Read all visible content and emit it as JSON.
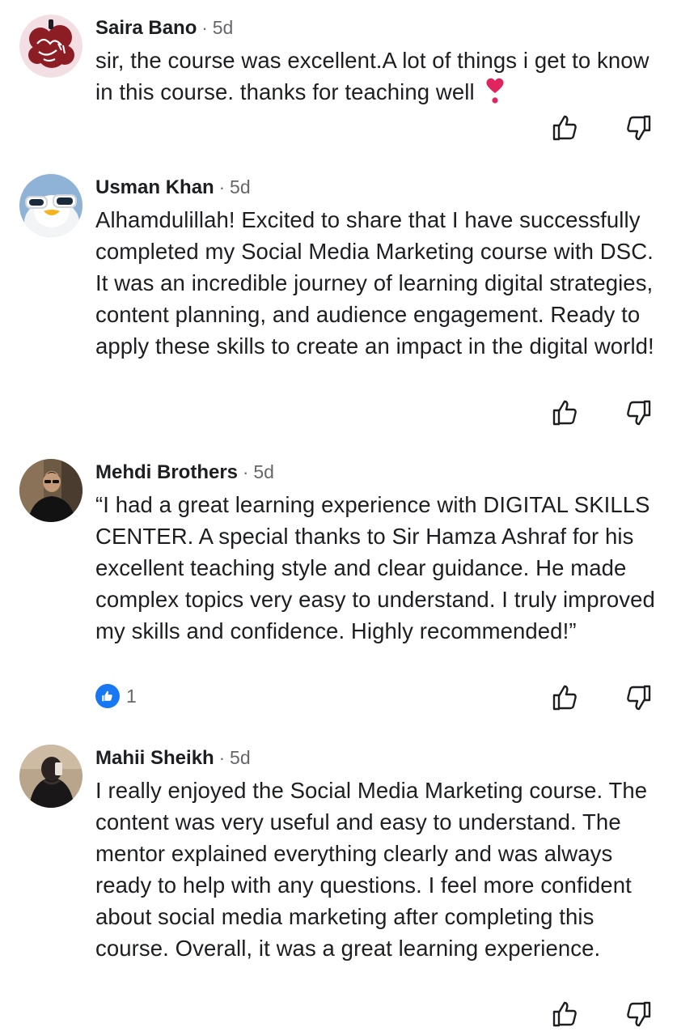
{
  "comments": [
    {
      "author": "Saira Bano",
      "separator": "·",
      "time": "5d",
      "text": "sir, the course was excellent.A lot of things i get to know in this course. thanks for teaching well",
      "emoji": "heart-exclamation-icon",
      "avatar": "calligraphy-avatar"
    },
    {
      "author": "Usman Khan",
      "separator": "·",
      "time": "5d",
      "text": "Alhamdulillah! Excited to share that I have successfully completed my Social Media Marketing course with DSC. It was an incredible journey of learning digital strategies, content planning, and audience engagement. Ready to apply these skills to create an impact in the digital world!",
      "avatar": "sunglasses-bird-avatar"
    },
    {
      "author": "Mehdi Brothers",
      "separator": "·",
      "time": "5d",
      "text": "“I had a great learning experience with DIGITAL SKILLS CENTER. A special thanks to Sir Hamza Ashraf for his excellent teaching style and clear guidance. He made complex topics very easy to understand. I truly improved my skills and confidence. Highly recommended!”",
      "reaction": {
        "type": "like",
        "count": "1"
      },
      "avatar": "man-portrait-avatar"
    },
    {
      "author": "Mahii Sheikh",
      "separator": "·",
      "time": "5d",
      "text": "I really enjoyed the Social Media Marketing course. The content was very useful and easy to understand. The mentor explained everything clearly and was always ready to help with any questions. I feel more confident about social media marketing after completing this course. Overall, it was a great learning experience.",
      "avatar": "woman-silhouette-avatar"
    }
  ],
  "colors": {
    "text": "#1c1e21",
    "secondary": "#65676b",
    "like_blue": "#1877f2",
    "heart_red": "#e0245e"
  },
  "icons": {
    "like": "thumbs-up-icon",
    "dislike": "thumbs-down-icon"
  }
}
